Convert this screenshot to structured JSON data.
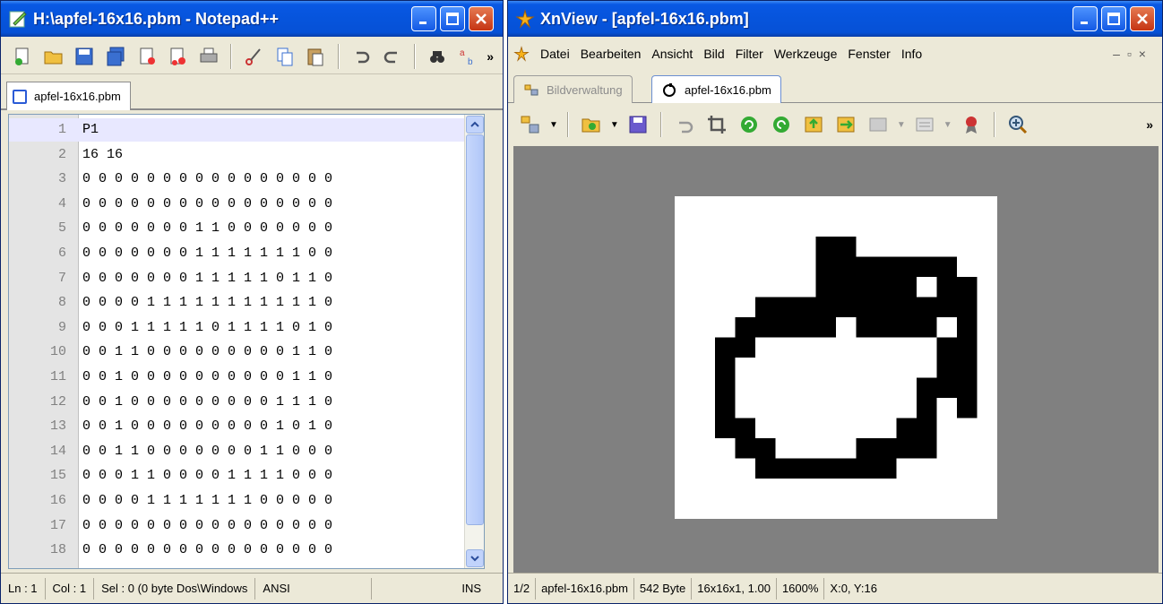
{
  "notepad": {
    "title": "H:\\apfel-16x16.pbm - Notepad++",
    "tab_label": "apfel-16x16.pbm",
    "lines": [
      "P1",
      "16 16",
      "0 0 0 0 0 0 0 0 0 0 0 0 0 0 0 0",
      "0 0 0 0 0 0 0 0 0 0 0 0 0 0 0 0",
      "0 0 0 0 0 0 0 1 1 0 0 0 0 0 0 0",
      "0 0 0 0 0 0 0 1 1 1 1 1 1 1 0 0",
      "0 0 0 0 0 0 0 1 1 1 1 1 0 1 1 0",
      "0 0 0 0 1 1 1 1 1 1 1 1 1 1 1 0",
      "0 0 0 1 1 1 1 1 0 1 1 1 1 0 1 0",
      "0 0 1 1 0 0 0 0 0 0 0 0 0 1 1 0",
      "0 0 1 0 0 0 0 0 0 0 0 0 0 1 1 0",
      "0 0 1 0 0 0 0 0 0 0 0 0 1 1 1 0",
      "0 0 1 0 0 0 0 0 0 0 0 0 1 0 1 0",
      "0 0 1 1 0 0 0 0 0 0 0 1 1 0 0 0",
      "0 0 0 1 1 0 0 0 0 1 1 1 1 0 0 0",
      "0 0 0 0 1 1 1 1 1 1 1 0 0 0 0 0",
      "0 0 0 0 0 0 0 0 0 0 0 0 0 0 0 0",
      "0 0 0 0 0 0 0 0 0 0 0 0 0 0 0 0"
    ],
    "status": {
      "ln": "Ln : 1",
      "col": "Col : 1",
      "sel": "Sel : 0 (0 byte Dos\\Windows",
      "encoding": "ANSI",
      "mode": "INS"
    }
  },
  "xnview": {
    "title": "XnView - [apfel-16x16.pbm]",
    "menu": [
      "Datei",
      "Bearbeiten",
      "Ansicht",
      "Bild",
      "Filter",
      "Werkzeuge",
      "Fenster",
      "Info"
    ],
    "tabs": [
      "Bildverwaltung",
      "apfel-16x16.pbm"
    ],
    "status": {
      "page": "1/2",
      "file": "apfel-16x16.pbm",
      "size": "542 Byte",
      "dims": "16x16x1, 1.00",
      "zoom": "1600%",
      "coords": "X:0, Y:16"
    }
  },
  "colors": {
    "titlebar": "#0654dc",
    "close_button": "#c53413",
    "viewer_background": "#808080"
  }
}
